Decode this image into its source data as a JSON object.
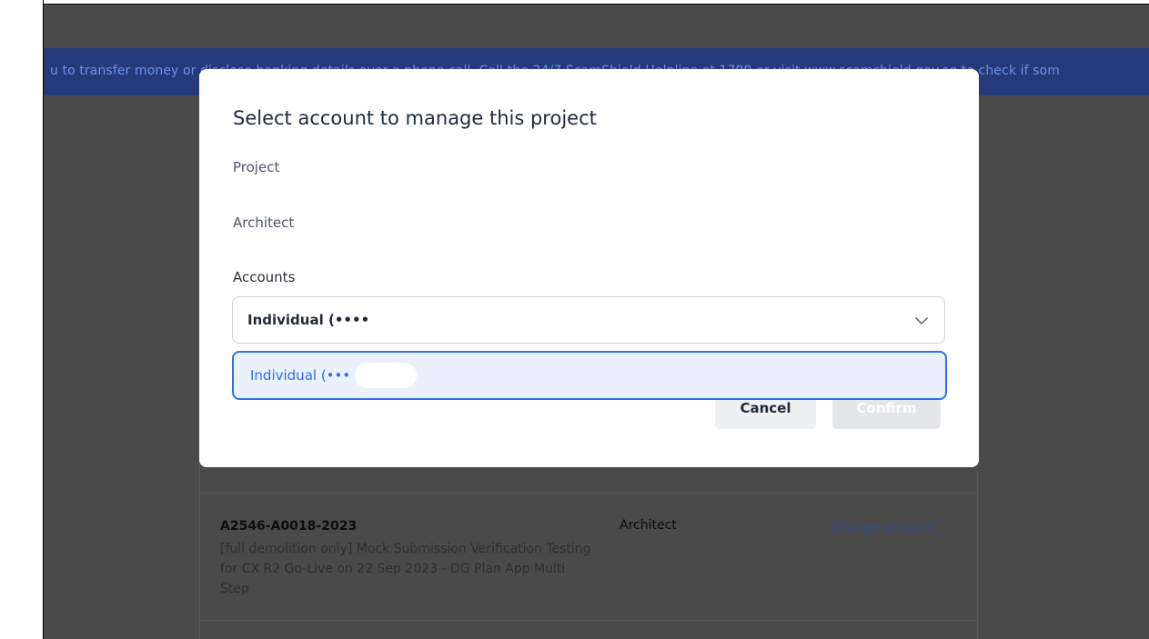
{
  "banner": {
    "text": "u to transfer money or disclose banking details over a phone call. Call the 24/7 ScamShield Helpline at 1799 or visit www.scamshield.gov.sg to check if som"
  },
  "modal": {
    "title": "Select account to manage this project",
    "project_label": "Project",
    "architect_label": "Architect",
    "accounts_label": "Accounts",
    "selected_account": "Individual (••••",
    "dropdown_option": "Individual (•••",
    "cancel_label": "Cancel",
    "confirm_label": "Confirm"
  },
  "project_row": {
    "id": "A2546-A0018-2023",
    "description": "[full demolition only] Mock Submission Verification Testing for CX R2 Go-Live on 22 Sep 2023 - DG Plan App Multi Step",
    "role": "Architect",
    "action": "Change account"
  },
  "colors": {
    "overlay": "#4a4a4a",
    "primary": "#2f6ee6",
    "option_bg": "#eaf1fd"
  }
}
